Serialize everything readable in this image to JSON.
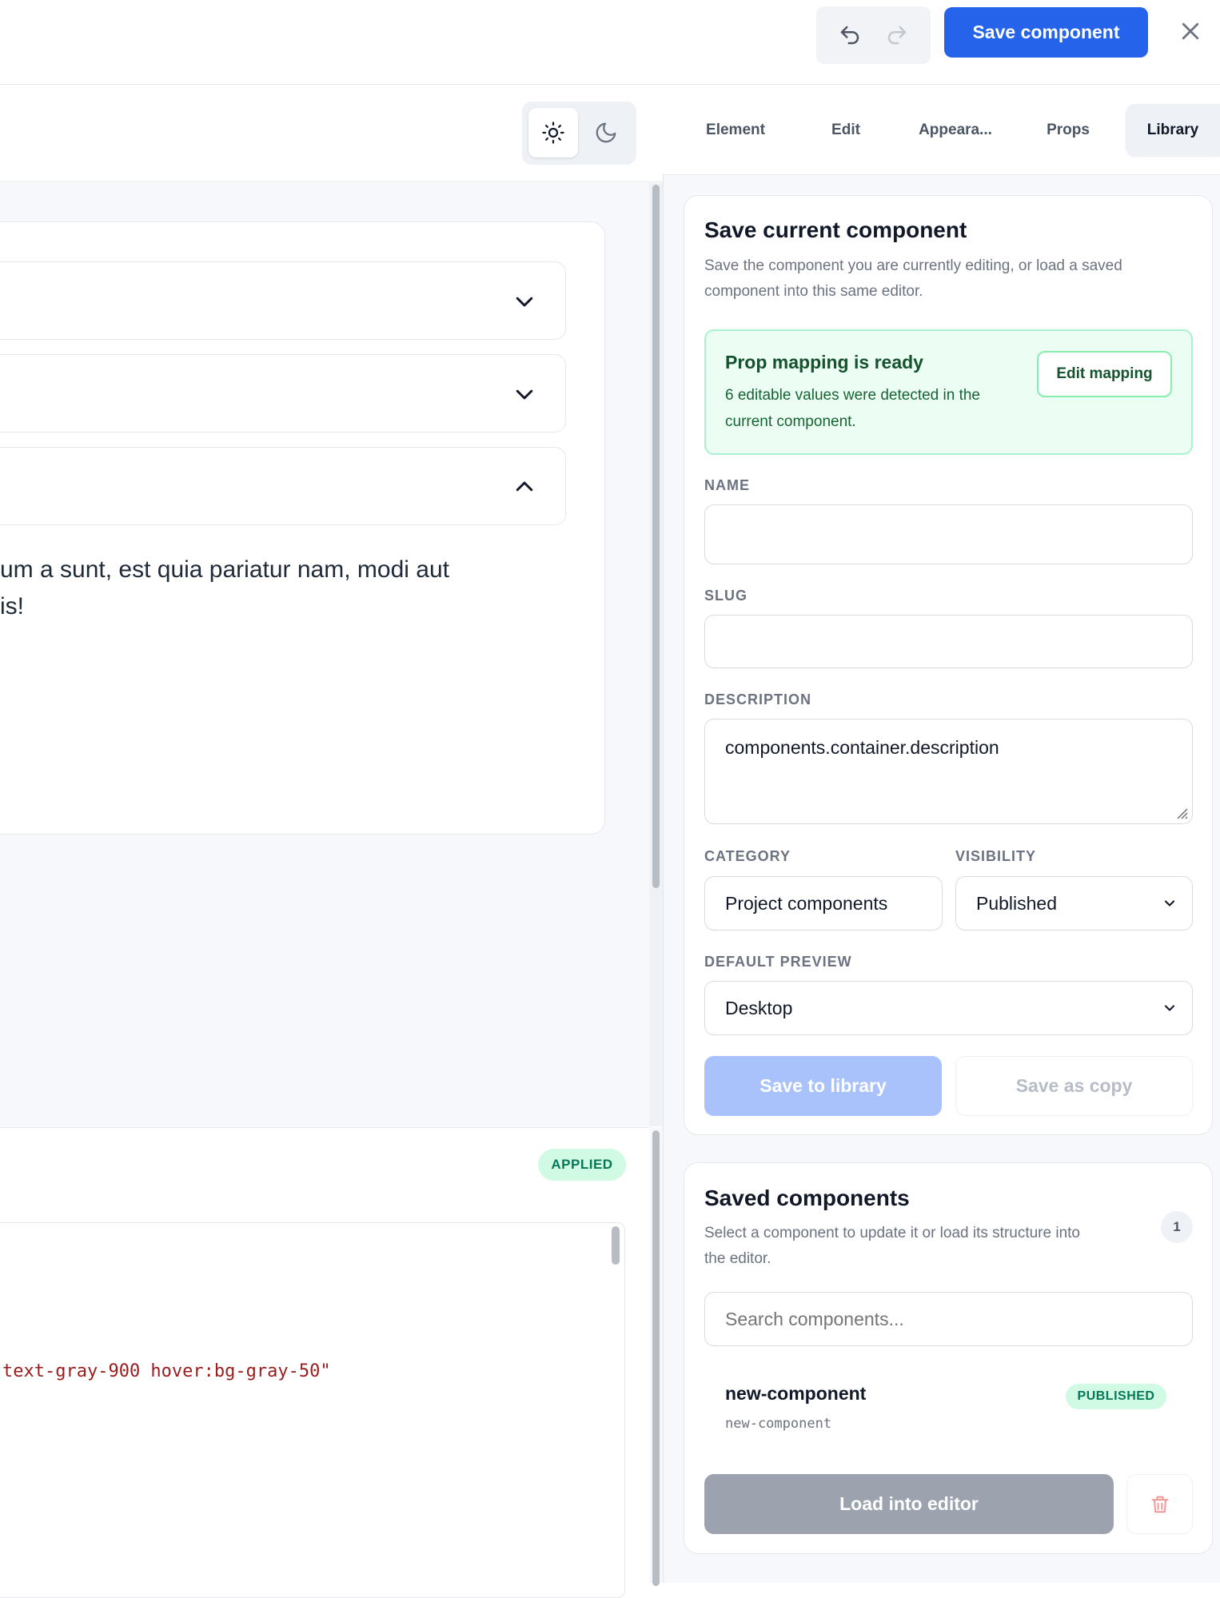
{
  "toolbar": {
    "undo_icon": "undo-icon",
    "redo_icon": "redo-icon",
    "save_label": "Save component",
    "close_icon": "close-icon",
    "accent": "#2563eb"
  },
  "theme": {
    "light_icon": "sun-icon",
    "dark_icon": "moon-icon",
    "selected": "light"
  },
  "canvas": {
    "accordions": [
      {
        "icon": "chevron-down-icon",
        "expanded": false
      },
      {
        "icon": "chevron-down-icon",
        "expanded": false
      },
      {
        "icon": "chevron-up-icon",
        "expanded": true
      }
    ],
    "body_text_line1": "um a sunt, est quia pariatur nam, modi aut",
    "body_text_line2": "is!"
  },
  "code": {
    "status_badge": "APPLIED",
    "visible_line": "text-gray-900 hover:bg-gray-50\""
  },
  "tabs": [
    {
      "label": "Element",
      "active": false
    },
    {
      "label": "Edit",
      "active": false
    },
    {
      "label": "Appeara...",
      "active": false
    },
    {
      "label": "Props",
      "active": false
    },
    {
      "label": "Library",
      "active": true
    }
  ],
  "save_section": {
    "title": "Save current component",
    "description_line1": "Save the component you are currently editing, or load a saved",
    "description_line2": "component into this same editor.",
    "banner": {
      "title": "Prop mapping is ready",
      "text_line1": "6 editable values were detected in the",
      "text_line2": "current component.",
      "button": "Edit mapping"
    },
    "fields": {
      "name_label": "NAME",
      "name_value": "",
      "slug_label": "SLUG",
      "slug_value": "",
      "description_label": "DESCRIPTION",
      "description_value": "components.container.description",
      "category_label": "CATEGORY",
      "category_value": "Project components",
      "visibility_label": "VISIBILITY",
      "visibility_value": "Published",
      "preview_label": "DEFAULT PREVIEW",
      "preview_value": "Desktop"
    },
    "save_button": "Save to library",
    "copy_button": "Save as copy"
  },
  "saved_section": {
    "title": "Saved components",
    "description_line1": "Select a component to update it or load its structure into",
    "description_line2": "the editor.",
    "count": "1",
    "search_placeholder": "Search components...",
    "items": [
      {
        "name": "new-component",
        "slug": "new-component",
        "status": "PUBLISHED"
      }
    ],
    "load_button": "Load into editor",
    "delete_icon": "trash-icon"
  }
}
